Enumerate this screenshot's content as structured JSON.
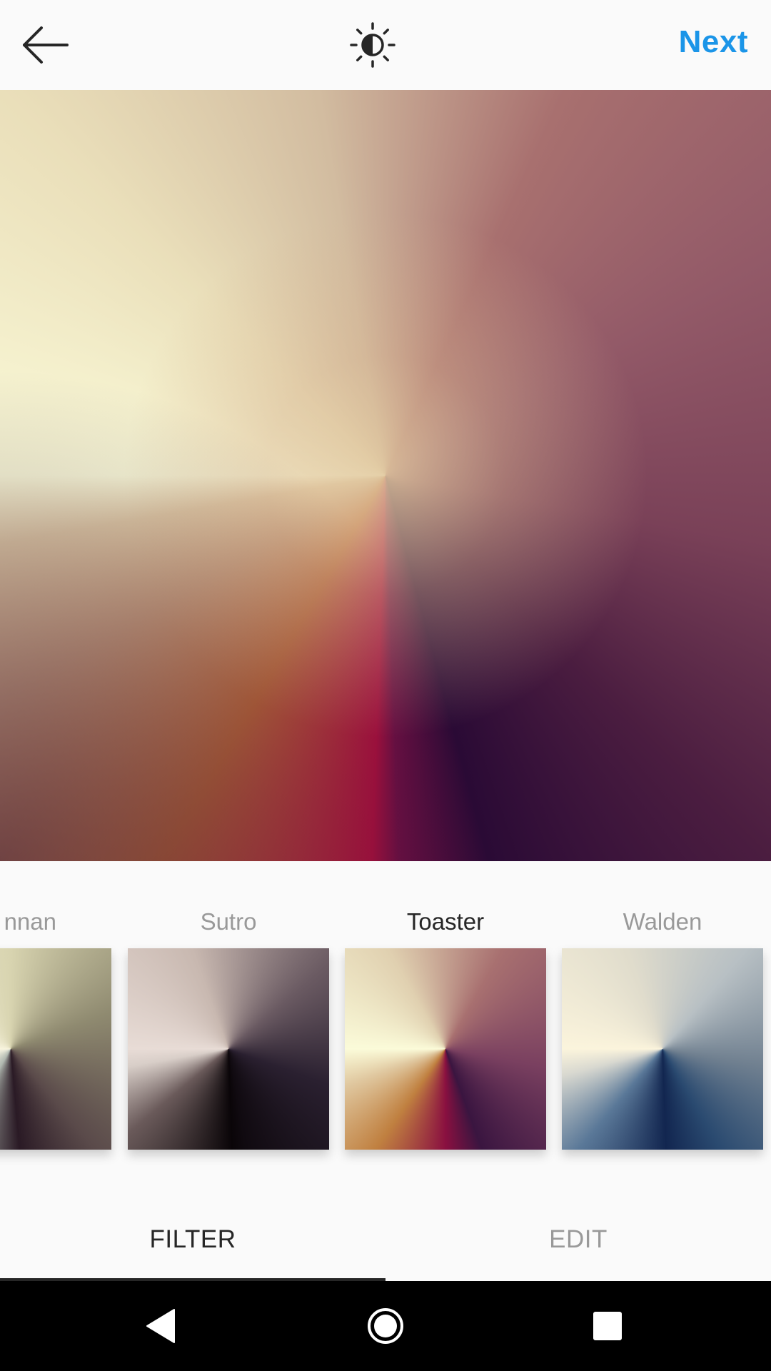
{
  "header": {
    "back_icon": "arrow-left-icon",
    "lux_icon": "brightness-contrast-icon",
    "next_label": "Next",
    "accent_color": "#1b95e8"
  },
  "filters": [
    {
      "label": "nnan",
      "selected": false
    },
    {
      "label": "Sutro",
      "selected": false
    },
    {
      "label": "Toaster",
      "selected": true
    },
    {
      "label": "Walden",
      "selected": false
    }
  ],
  "tabs": {
    "filter_label": "FILTER",
    "edit_label": "EDIT",
    "active": "FILTER"
  },
  "system_nav": {
    "back_icon": "triangle-back-icon",
    "home_icon": "circle-home-icon",
    "recents_icon": "square-recents-icon"
  }
}
